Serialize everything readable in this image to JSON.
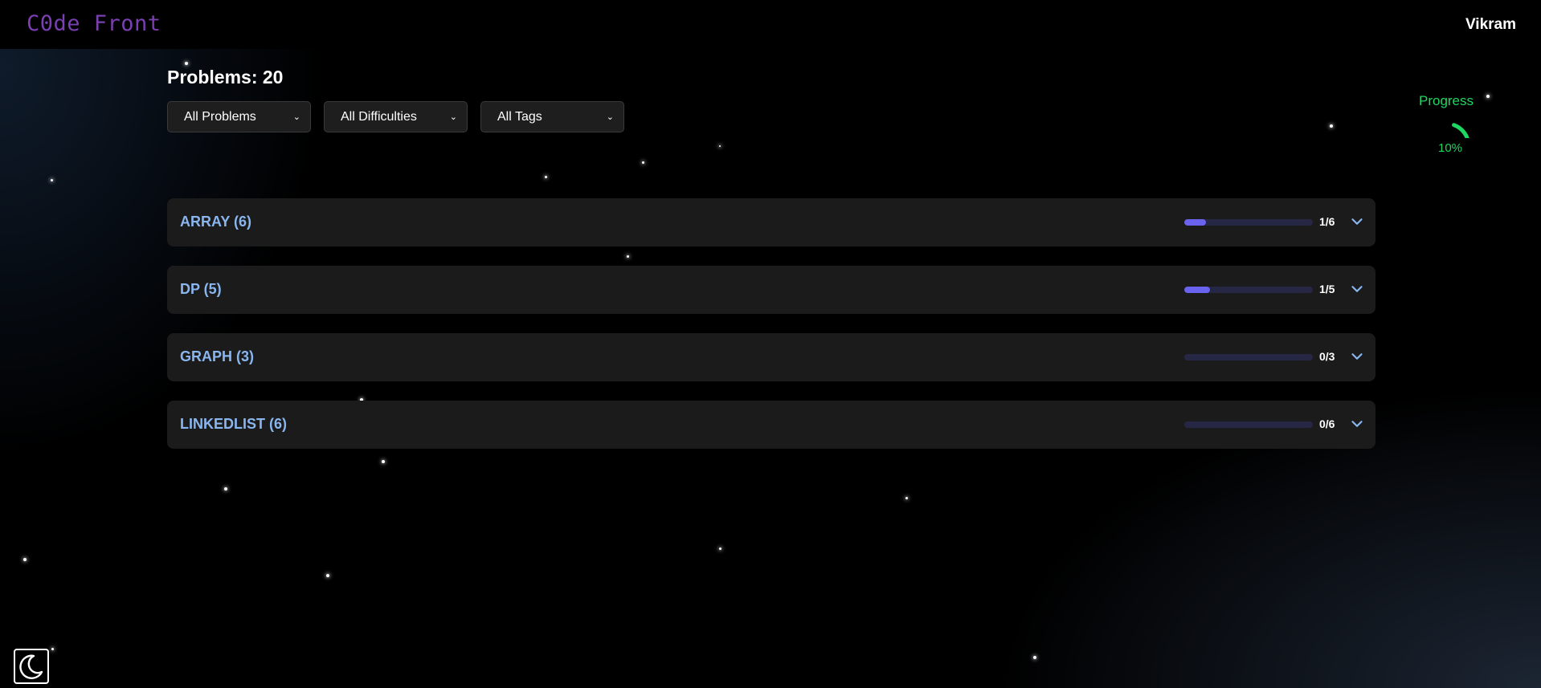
{
  "app": {
    "logo": "C0de Front",
    "username": "Vikram"
  },
  "problems": {
    "title": "Problems: 20"
  },
  "filters": [
    {
      "label": "All Problems"
    },
    {
      "label": "All Difficulties"
    },
    {
      "label": "All Tags"
    }
  ],
  "sections": [
    {
      "title": "ARRAY (6)",
      "solved": 1,
      "total": 6,
      "count_label": "1/6"
    },
    {
      "title": "DP (5)",
      "solved": 1,
      "total": 5,
      "count_label": "1/5"
    },
    {
      "title": "GRAPH (3)",
      "solved": 0,
      "total": 3,
      "count_label": "0/3"
    },
    {
      "title": "LINKEDLIST (6)",
      "solved": 0,
      "total": 6,
      "count_label": "0/6"
    }
  ],
  "progress": {
    "label": "Progress",
    "percent_label": "10%",
    "fraction": 0.1
  },
  "icons": {
    "expand": "chevron-down-icon",
    "filter": "chevron-down-icon",
    "theme": "moon-icon"
  },
  "colors": {
    "accent_logo": "#7a3fb0",
    "section_title": "#8ab6ef",
    "progress_fill": "#6a63f0",
    "progress_green": "#1ed760"
  }
}
